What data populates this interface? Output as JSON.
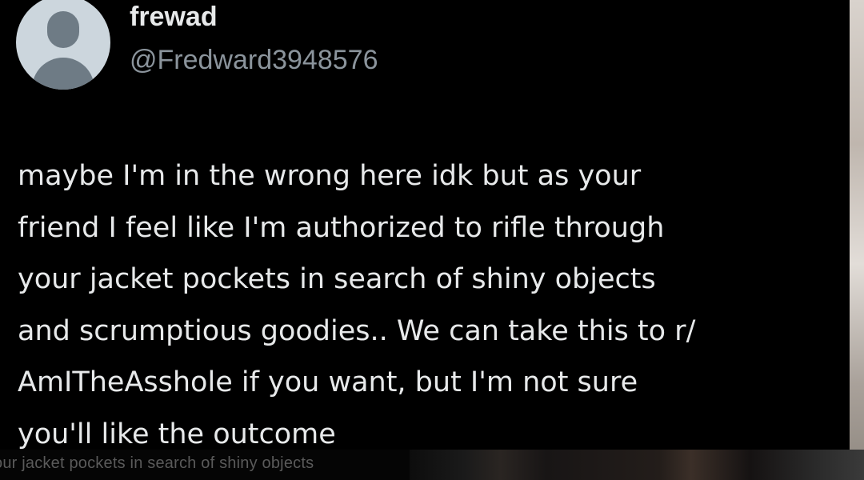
{
  "tweet": {
    "author": {
      "display_name": "frewad",
      "handle": "@Fredward3948576",
      "avatar_icon": "default-profile-icon"
    },
    "text_lines": [
      "maybe I'm in the wrong here idk but as your",
      "friend I feel like I'm authorized to rifle through",
      "your jacket pockets in search of shiny objects",
      "and scrumptious goodies.. We can take this to r/",
      "AmITheAsshole if you want, but I'm not sure",
      "you'll like the outcome"
    ]
  },
  "background": {
    "ghost_text": "our jacket pockets in search of shiny objects"
  },
  "colors": {
    "card_background": "#000000",
    "primary_text": "#e7e9ea",
    "secondary_text": "#8b949c",
    "avatar_background": "#ccd6dd",
    "avatar_silhouette": "#6e7b85"
  }
}
